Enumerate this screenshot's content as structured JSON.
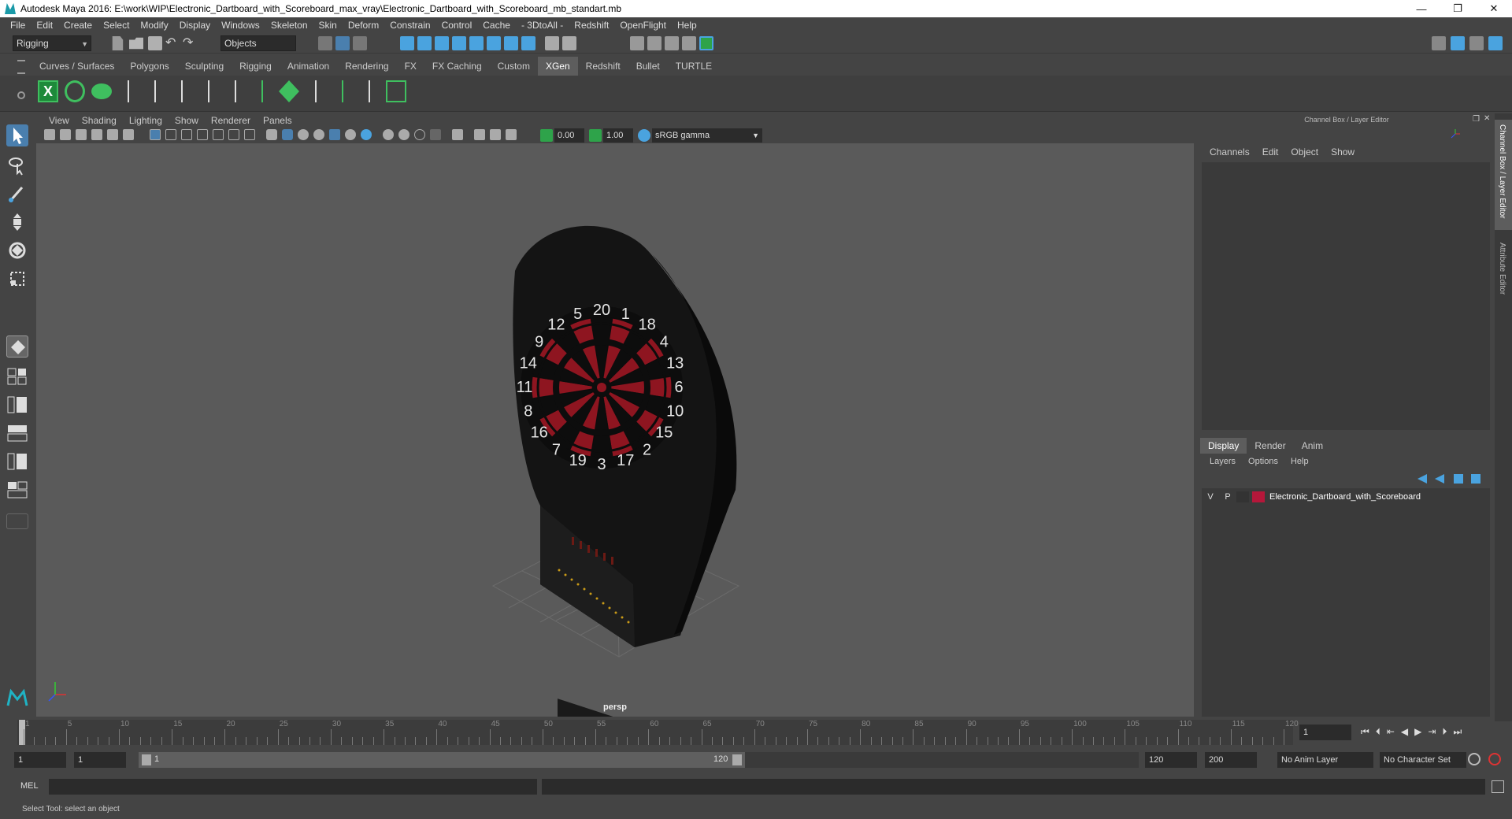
{
  "window": {
    "title": "Autodesk Maya 2016: E:\\work\\WIP\\Electronic_Dartboard_with_Scoreboard_max_vray\\Electronic_Dartboard_with_Scoreboard_mb_standart.mb",
    "minimize": "—",
    "restore": "❐",
    "close": "✕"
  },
  "menubar": [
    "File",
    "Edit",
    "Create",
    "Select",
    "Modify",
    "Display",
    "Windows",
    "Skeleton",
    "Skin",
    "Deform",
    "Constrain",
    "Control",
    "Cache",
    "- 3DtoAll -",
    "Redshift",
    "OpenFlight",
    "Help"
  ],
  "statusline": {
    "menuset": "Rigging",
    "selection_mode": "Objects"
  },
  "shelf": {
    "tabs": [
      "Curves / Surfaces",
      "Polygons",
      "Sculpting",
      "Rigging",
      "Animation",
      "Rendering",
      "FX",
      "FX Caching",
      "Custom",
      "XGen",
      "Redshift",
      "Bullet",
      "TURTLE"
    ],
    "active_tab": "XGen"
  },
  "viewport": {
    "menus": [
      "View",
      "Shading",
      "Lighting",
      "Show",
      "Renderer",
      "Panels"
    ],
    "exposure": "0.00",
    "gamma": "1.00",
    "colorspace": "sRGB gamma",
    "camera_label": "persp",
    "dartboard_numbers": [
      "20",
      "1",
      "18",
      "4",
      "13",
      "6",
      "10",
      "15",
      "2",
      "17",
      "3",
      "19",
      "7",
      "16",
      "8",
      "11",
      "14",
      "9",
      "12",
      "5"
    ]
  },
  "channel_box": {
    "header": "Channel Box / Layer Editor",
    "menus": [
      "Channels",
      "Edit",
      "Object",
      "Show"
    ],
    "layer_tabs": [
      "Display",
      "Render",
      "Anim"
    ],
    "active_layer_tab": "Display",
    "layer_menus": [
      "Layers",
      "Options",
      "Help"
    ],
    "layers": [
      {
        "v": "V",
        "p": "P",
        "name": "Electronic_Dartboard_with_Scoreboard",
        "color": "#b5173a"
      }
    ],
    "side_tabs": [
      "Channel Box / Layer Editor",
      "Attribute Editor"
    ]
  },
  "timeline": {
    "ticks": [
      "1",
      "5",
      "10",
      "15",
      "20",
      "25",
      "30",
      "35",
      "40",
      "45",
      "50",
      "55",
      "60",
      "65",
      "70",
      "75",
      "80",
      "85",
      "90",
      "95",
      "100",
      "105",
      "110",
      "115",
      "120"
    ],
    "current_frame": "1"
  },
  "range": {
    "start": "1",
    "playback_start": "1",
    "slider_start": "1",
    "slider_end": "120",
    "playback_end": "120",
    "end": "200",
    "anim_layer": "No Anim Layer",
    "character_set": "No Character Set"
  },
  "command_line": {
    "label": "MEL"
  },
  "help_line": {
    "text": "Select Tool: select an object"
  },
  "colors": {
    "accent_blue": "#4aa3df",
    "layer_red": "#b5173a",
    "dart_red": "#8e1520",
    "viewport_bg": "#5a5a5a"
  }
}
